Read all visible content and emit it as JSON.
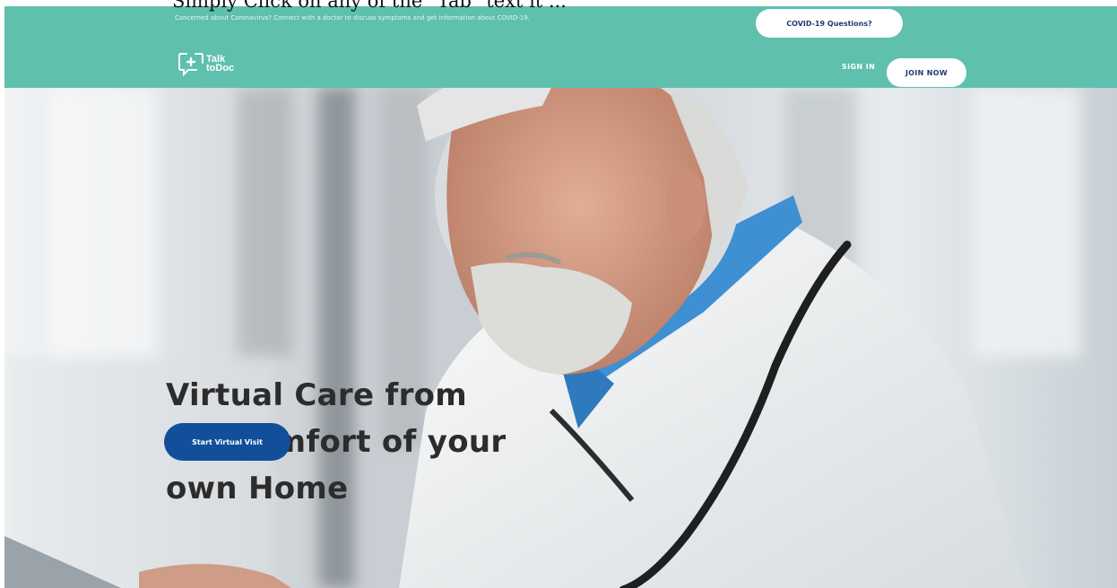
{
  "caption": "Simply Click on any of the \"Tab\" text it ...",
  "header": {
    "notice": "Concerned about Coronavirus? Connect with a doctor to discuss symptoms and get information about COVID-19.",
    "covid_button": "COVID-19 Questions?",
    "logo_line1": "Talk",
    "logo_line2": "toDoc",
    "signin": "SIGN IN",
    "join": "JOIN NOW",
    "bg_color": "#5ec0ad"
  },
  "hero": {
    "headline_lines": [
      "Virtual Care from",
      "the comfort of your",
      "own Home"
    ],
    "cta": "Start Virtual Visit",
    "cta_color": "#114f9b"
  }
}
